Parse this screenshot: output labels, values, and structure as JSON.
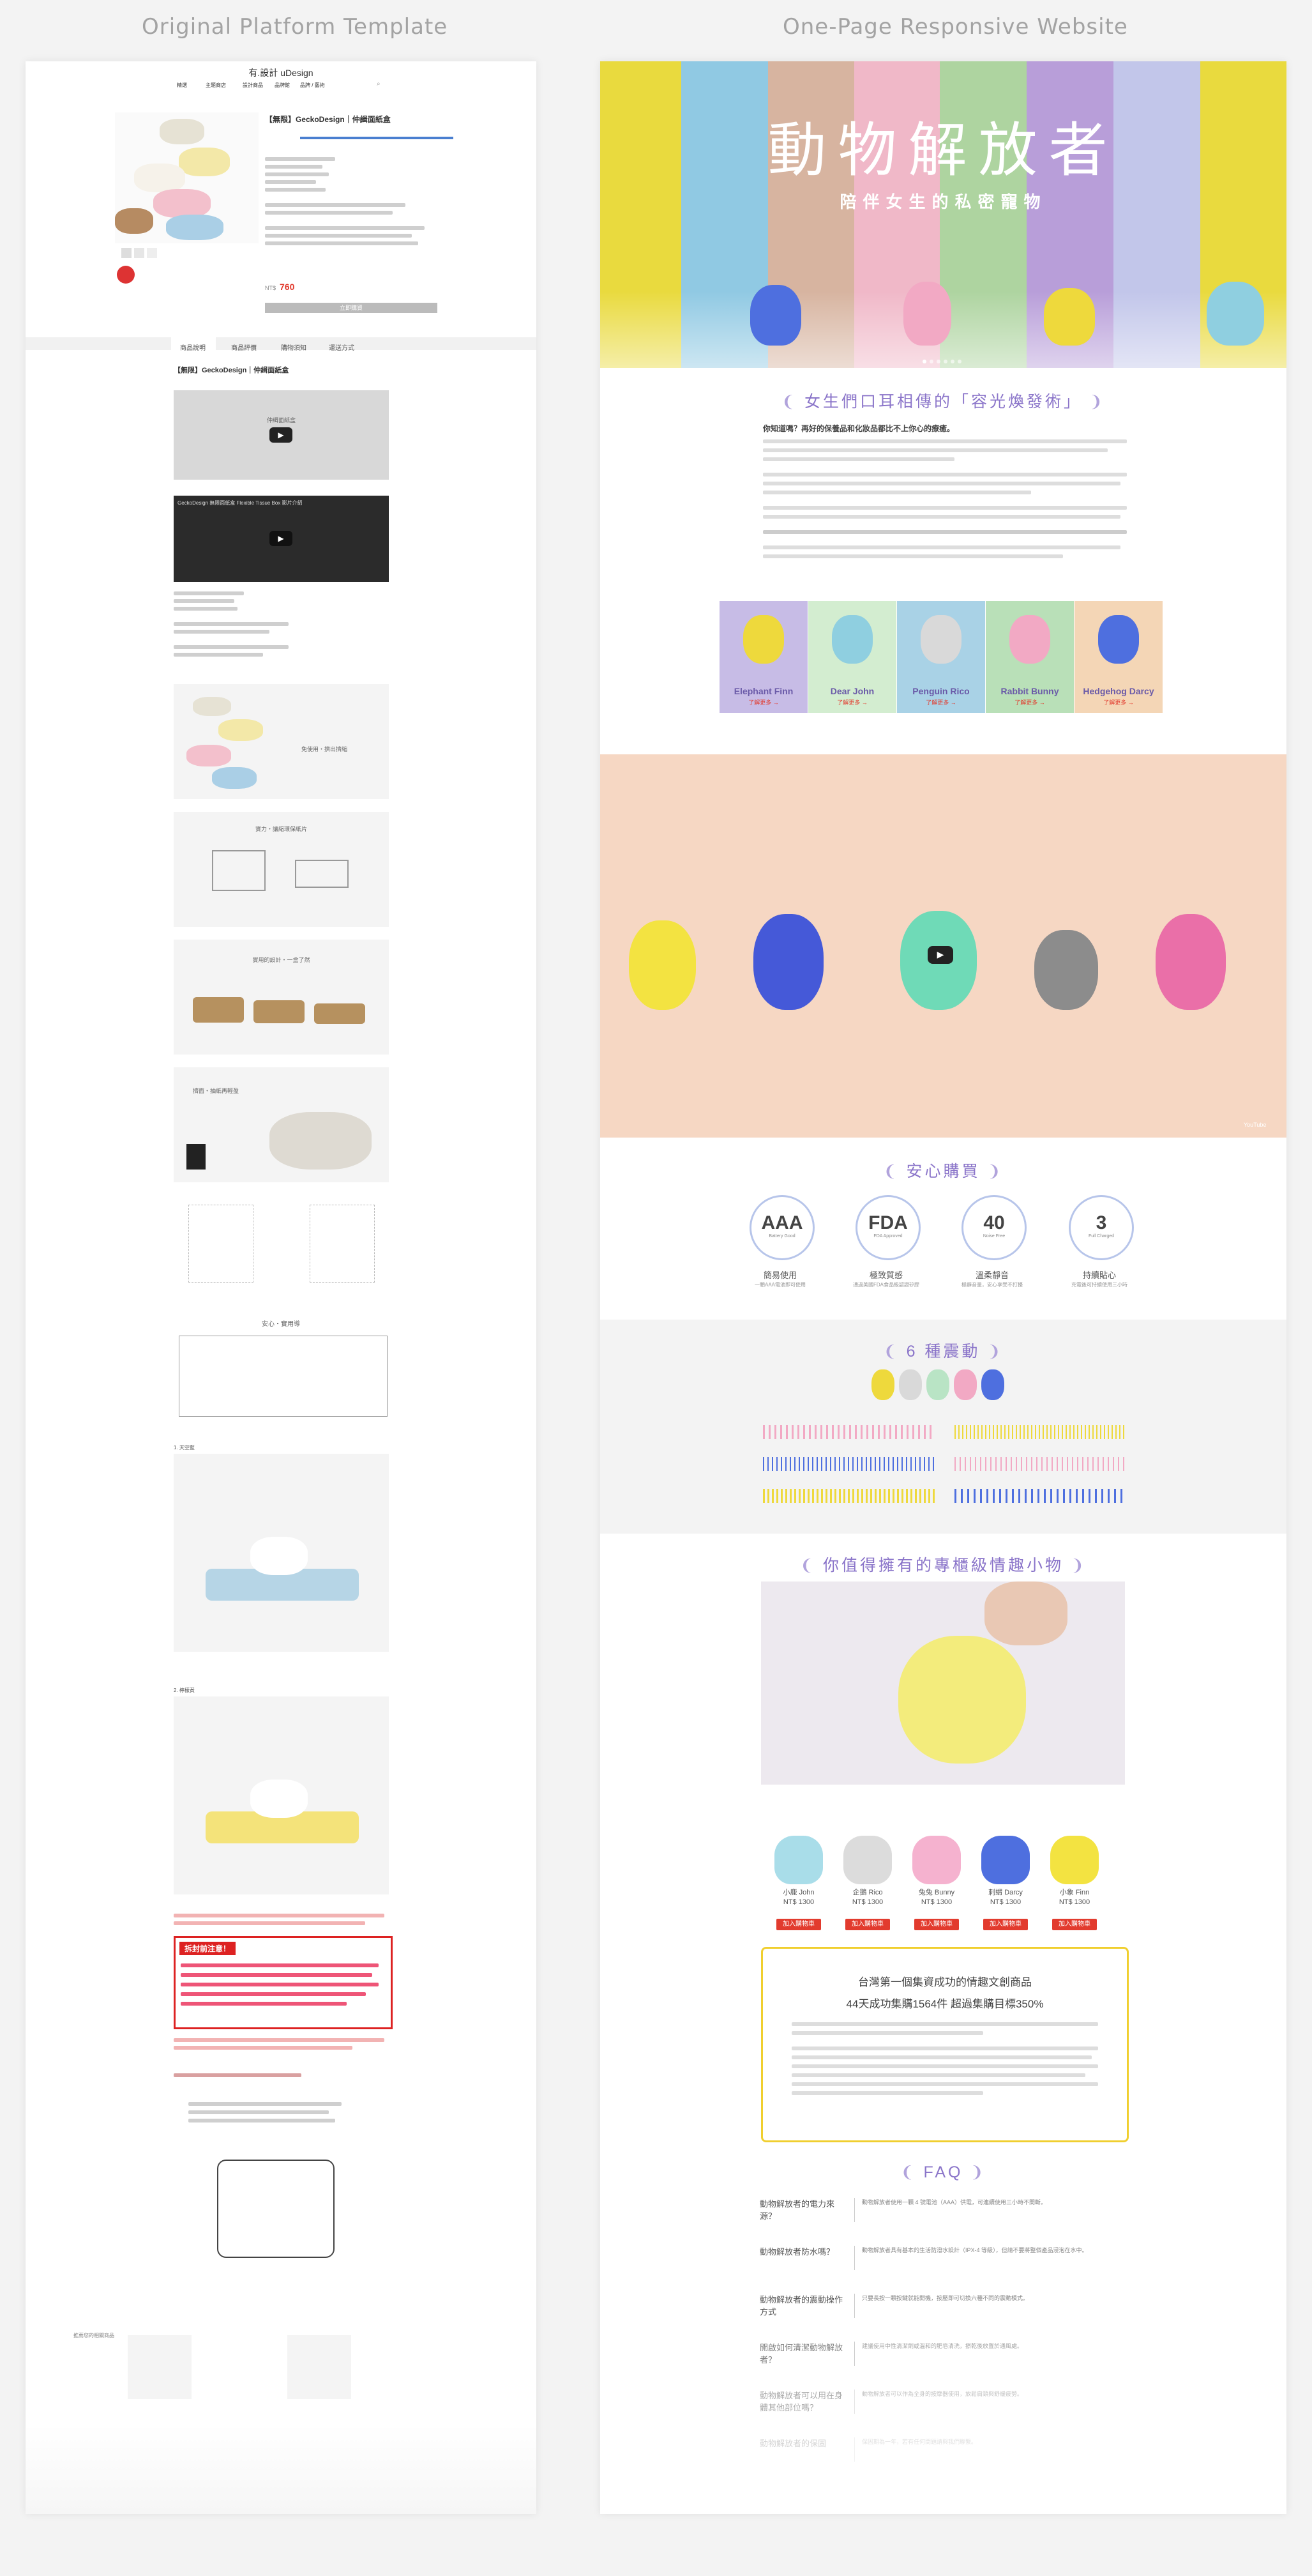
{
  "headings": {
    "left": "Original Platform Template",
    "right": "One-Page Responsive Website"
  },
  "left": {
    "logo": "有.設計 uDesign",
    "nav": [
      "精選",
      "主題商店",
      "設計商品",
      "品牌館",
      "品牌 / 藝術"
    ],
    "product_title": "【無限】GeckoDesign｜仲緝面紙盒",
    "price_label": "NT$",
    "price": "760",
    "buy_button": "立即購買",
    "tabs": [
      "商品說明",
      "商品評價",
      "購物須知",
      "運送方式"
    ],
    "desc_title": "【無限】GeckoDesign｜仲緝面紙盒",
    "video1_title": "仲緝面紙盒",
    "video2_title": "GeckoDesign 無限面紙盒 Flexible Tissue Box 影片介紹",
    "img_caption1": "免使用・擠出擠縮",
    "img_caption2": "實力・讓縮環保紙片",
    "img_caption3": "實用的設計・一盒了然",
    "img_caption4": "擠面・抽紙再輕盈",
    "diagram_title": "安心・實用導",
    "color1": "1. 天空藍",
    "color2": "2. 檸檬黃",
    "notice_title": "拆封前注意！",
    "related": "推薦您的相關商品"
  },
  "right": {
    "hero_title": "動物解放者",
    "hero_subtitle": "陪伴女生的私密寵物",
    "section1_title": "女生們口耳相傳的「容光煥發術」",
    "section1_lead": "你知道嗎？再好的保養品和化妝品都比不上你心的療癒。",
    "animals": [
      {
        "name": "Elephant Finn",
        "cta": "了解更多 →"
      },
      {
        "name": "Dear John",
        "cta": "了解更多 →"
      },
      {
        "name": "Penguin Rico",
        "cta": "了解更多 →"
      },
      {
        "name": "Rabbit Bunny",
        "cta": "了解更多 →"
      },
      {
        "name": "Hedgehog Darcy",
        "cta": "了解更多 →"
      }
    ],
    "video_logo": "YouTube",
    "section2_title": "安心購買",
    "badges": [
      {
        "value": "AAA",
        "sub": "Battery Good",
        "label": "簡易使用",
        "desc": "一顆AAA電池即可使用"
      },
      {
        "value": "FDA",
        "sub": "FDA Approved",
        "label": "極致質感",
        "desc": "通過美國FDA食品級認證矽膠"
      },
      {
        "value": "40",
        "sub": "Noise Free",
        "label": "溫柔靜音",
        "desc": "極靜音量，安心享受不打擾"
      },
      {
        "value": "3",
        "sub": "Full Charged",
        "label": "持續貼心",
        "desc": "充電後可持續使用三小時"
      }
    ],
    "section3_title": "6 種震動",
    "section4_title": "你值得擁有的專櫃級情趣小物",
    "products": [
      {
        "name": "小鹿 John",
        "price": "NT$ 1300",
        "cta": "加入購物車"
      },
      {
        "name": "企鵝 Rico",
        "price": "NT$ 1300",
        "cta": "加入購物車"
      },
      {
        "name": "兔兔 Bunny",
        "price": "NT$ 1300",
        "cta": "加入購物車"
      },
      {
        "name": "刺蝟 Darcy",
        "price": "NT$ 1300",
        "cta": "加入購物車"
      },
      {
        "name": "小象 Finn",
        "price": "NT$ 1300",
        "cta": "加入購物車"
      }
    ],
    "promo": {
      "title1": "台灣第一個集資成功的情趣文創商品",
      "title2": "44天成功集購1564件  超過集購目標350%"
    },
    "faq_title": "FAQ",
    "faq": [
      {
        "q": "動物解放者的電力來源？",
        "a": "動物解放者使用一顆 4 號電池（AAA）供電，可連續使用三小時不間斷。"
      },
      {
        "q": "動物解放者防水嗎？",
        "a": "動物解放者具有基本的生活防潑水設計（IPX-4 等級），但請不要將整個產品浸泡在水中。"
      },
      {
        "q": "動物解放者的震動操作方式",
        "a": "只要長按一顆按鍵就能開機，按壓即可切換六種不同的震動模式。"
      },
      {
        "q": "開啟如何清潔動物解放者？",
        "a": "建議使用中性清潔劑或溫和的肥皂清洗，擦乾後放置於通風處。"
      },
      {
        "q": "動物解放者可以用在身體其他部位嗎？",
        "a": "動物解放者可以作為全身的按摩器使用，放鬆肩頸與舒緩疲勞。"
      },
      {
        "q": "動物解放者的保固",
        "a": "保固期為一年，若有任何問題請與我們聯繫。"
      }
    ]
  },
  "colors": {
    "accent": "#8a74c9",
    "peach": "#f6d7c3",
    "red": "#e23b2e",
    "promo_border": "#f0cf2f"
  }
}
